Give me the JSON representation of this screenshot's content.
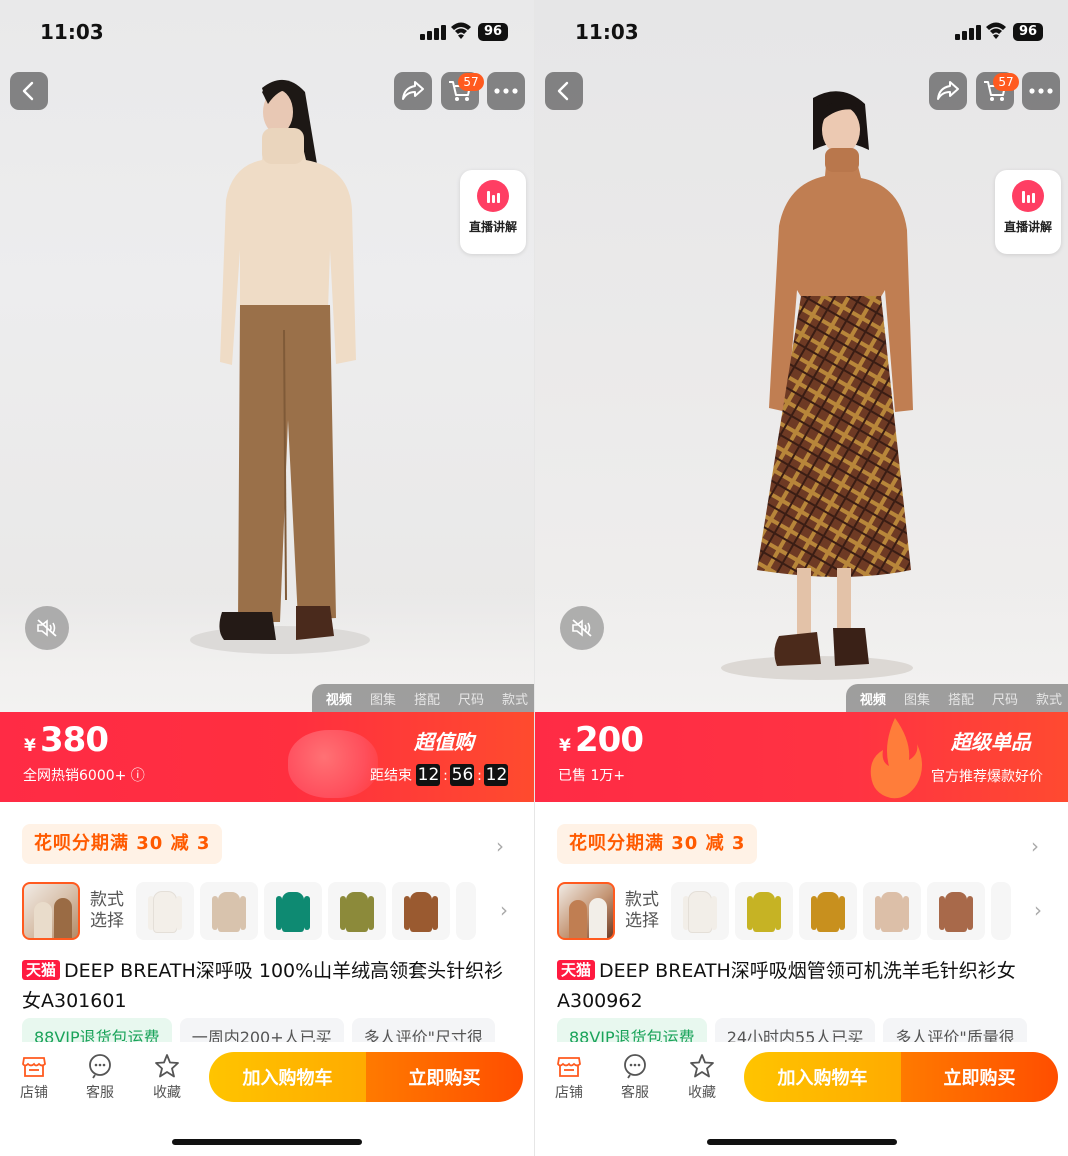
{
  "screens": [
    {
      "status": {
        "time": "11:03",
        "battery": "96"
      },
      "cart_count": "57",
      "live_label": "直播讲解",
      "media_tabs": [
        "视频",
        "图集",
        "搭配",
        "尺码",
        "款式"
      ],
      "price": {
        "currency": "¥",
        "value": "380",
        "sub": "全网热销6000+ ⓘ"
      },
      "promo_badge": "超值购",
      "countdown": {
        "label": "距结束",
        "h": "12",
        "m": "56",
        "s": "12"
      },
      "installment": "花呗分期满 30 减 3",
      "style_select_label": [
        "款式",
        "选择"
      ],
      "title_badge": "天猫",
      "title": "DEEP BREATH深呼吸 100%山羊绒高领套头针织衫女A301601",
      "chips": [
        "88VIP退货包运费",
        "一周内200+人已买",
        "多人评价\"尺寸很"
      ],
      "nav": [
        "店铺",
        "客服",
        "收藏"
      ],
      "add_cart": "加入购物车",
      "buy_now": "立即购买",
      "colors": {
        "swatches": [
          "#f3efe9",
          "#d8c3ad",
          "#0e8a72",
          "#8c8a3a",
          "#9a5a30"
        ]
      }
    },
    {
      "status": {
        "time": "11:03",
        "battery": "96"
      },
      "cart_count": "57",
      "live_label": "直播讲解",
      "media_tabs": [
        "视频",
        "图集",
        "搭配",
        "尺码",
        "款式"
      ],
      "price": {
        "currency": "¥",
        "value": "200",
        "sub": "已售 1万+"
      },
      "promo_badge": "超级单品",
      "promo_sub": "官方推荐爆款好价",
      "installment": "花呗分期满 30 减 3",
      "style_select_label": [
        "款式",
        "选择"
      ],
      "title_badge": "天猫",
      "title": "DEEP BREATH深呼吸烟管领可机洗羊毛针织衫女A300962",
      "chips": [
        "88VIP退货包运费",
        "24小时内55人已买",
        "多人评价\"质量很"
      ],
      "nav": [
        "店铺",
        "客服",
        "收藏"
      ],
      "add_cart": "加入购物车",
      "buy_now": "立即购买",
      "colors": {
        "swatches": [
          "#f2eee8",
          "#c6b324",
          "#c8901e",
          "#dcbfa8",
          "#a8694a"
        ]
      }
    }
  ],
  "theme": {
    "accent": "#ff2b45",
    "orange": "#ff5a1f",
    "tmall": "#ff1a40"
  }
}
